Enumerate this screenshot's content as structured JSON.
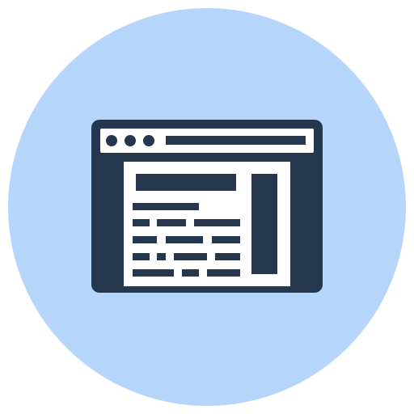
{
  "icon": {
    "name": "web-browser-page-icon",
    "colors": {
      "background": "#ffffff",
      "circle": "#b5d5fb",
      "window": "#25374f",
      "content": "#ffffff"
    }
  }
}
